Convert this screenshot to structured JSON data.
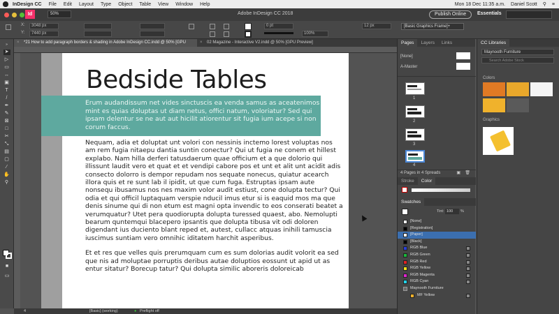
{
  "menubar": {
    "app": "InDesign CC",
    "items": [
      "File",
      "Edit",
      "Layout",
      "Type",
      "Object",
      "Table",
      "View",
      "Window",
      "Help"
    ],
    "datetime": "Mon 18 Dec  11:35 a.m.",
    "user": "Daniel Scott"
  },
  "appbar": {
    "zoom": "50%",
    "title": "Adobe InDesign CC 2018",
    "publish_label": "Publish Online",
    "workspace": "Essentials"
  },
  "controlbar": {
    "x": "3048 px",
    "y": "7440 px",
    "stroke_weight": "0 pt",
    "zoom": "100%",
    "font_size": "12 px",
    "object_style": "[Basic Graphics Frame]+"
  },
  "doctabs": [
    {
      "label": "*21 How to add paragraph borders & shading in Adobe InDesign CC.indd @ 50% [GPU Preview]",
      "active": true
    },
    {
      "label": "02 Magazine - Interactive V2.indd @ 50% [GPU Preview]",
      "active": false
    }
  ],
  "document": {
    "title": "Bedside Tables",
    "intro": "Erum audandissum net vides sinctuscis ea venda samus as aceatenimos mint es quias doluptas ut diam netus, offici natum, voloriatur? Sed qui ipsam delentur se ne aut aut hicilit atiorentur sit fugia ium acepe si non corum faccus.",
    "para1": "Nequam, adia et doluptat unt volori con nessinis inctemo lorest voluptas nos am rem fugia nitaepu dantia suntin conectur? Qui ut fugia ne conem et hillest explabo. Nam hilla derferi tatusdaerum quae officium et a que dolorio qui illissunt laudit vero et quat et et vendipi cabore pos et unt et alit unt acidit adis consecto dolorro is dempor repudam nos sequate nonecus, quiatur acearch illora quis et re sunt lab il ipidit, ut que cum fuga. Estruptas ipsam aute nonsequ ibusamus nos nes maxim volor audit estiust, cone dolupta tectur? Qui odia et qui officil luptaquam verspie nducil imus etur si is eaquid mos ma que denis sinume qui di non etum est magni opta invendic to eos conserati beatet a verumquatur? Utet pera quodiorupta dolupta turessed quaest, abo. Nemolupti bearum quntemqui blacepero ipsantis que dolupta tibusa vit odi doloren digendant ius duciento blant reped et, autest, cullacc atquas inihili tamuscia iuscimus suntiam vero omnihic iditatem harchit asperibus.",
    "para2": "Et et res que velles quis prerumquam cum es sum dolorias audit volorit ea sed que nis ad moluptae porruptis deribus autae doluptios eossunt ut apid ut as entur sitatur? Borecup tatur? Qui dolupta similic aboreris doloreicab"
  },
  "statusbar": {
    "page": "4",
    "style": "[Basic] (working)",
    "preflight": "Preflight off"
  },
  "pages_panel": {
    "tabs": [
      "Pages",
      "Layers",
      "Links"
    ],
    "none_label": "[None]",
    "master_label": "A-Master",
    "page_numbers": [
      "1",
      "2",
      "3",
      "4"
    ],
    "footer": "4 Pages in 4 Spreads"
  },
  "stroke_panel": {
    "tabs": [
      "Stroke",
      "Color"
    ]
  },
  "swatches_panel": {
    "title": "Swatches",
    "tint_label": "Tint:",
    "tint_value": "100",
    "tint_unit": "%",
    "items": [
      {
        "name": "[None]",
        "color": "#ffffff"
      },
      {
        "name": "[Registration]",
        "color": "#000000"
      },
      {
        "name": "[Paper]",
        "color": "#ffffff"
      },
      {
        "name": "[Black]",
        "color": "#000000"
      },
      {
        "name": "RGB Blue",
        "color": "#2a3fd8"
      },
      {
        "name": "RGB Green",
        "color": "#19b83a"
      },
      {
        "name": "RGB Red",
        "color": "#e02323"
      },
      {
        "name": "RGB Yellow",
        "color": "#f2e11a"
      },
      {
        "name": "RGB Magenta",
        "color": "#e023d0"
      },
      {
        "name": "RGB Cyan",
        "color": "#22d3e8"
      },
      {
        "name": "Maynooth Furniture",
        "color": "#6b6b6b"
      },
      {
        "name": "MF Yellow",
        "color": "#f0b22c"
      }
    ],
    "selected": "[Paper]"
  },
  "cc_libraries": {
    "title": "CC Libraries",
    "library": "Maynooth Furniture",
    "search_placeholder": "Search Adobe Stock",
    "colors_label": "Colors",
    "graphics_label": "Graphics",
    "colors": [
      "#e07a24",
      "#e9a82b",
      "#f4f4f4",
      "#f0b22c",
      "#5a5a5a"
    ]
  },
  "accent": "#5ea99f"
}
